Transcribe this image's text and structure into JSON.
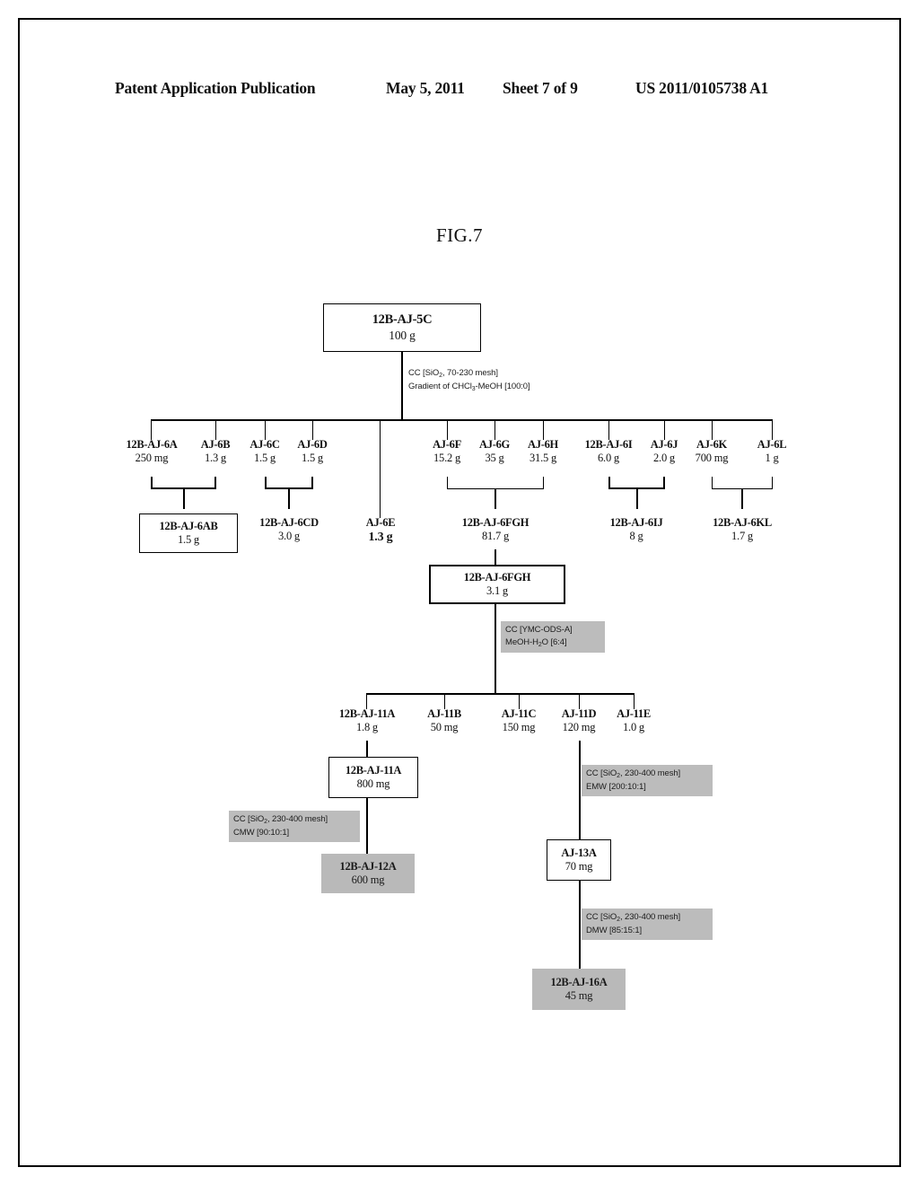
{
  "header": {
    "publication": "Patent Application Publication",
    "date": "May 5, 2011",
    "sheet": "Sheet 7 of 9",
    "number": "US 2011/0105738 A1"
  },
  "figure": {
    "title": "FIG.7",
    "type": "flowchart",
    "description": "Isolation / fractionation scheme of extract 12B-AJ-5C"
  },
  "nodes": {
    "root": {
      "name": "12B-AJ-5C",
      "weight": "100 g"
    },
    "aj6a": {
      "name": "12B-AJ-6A",
      "weight": "250 mg"
    },
    "aj6b": {
      "name": "AJ-6B",
      "weight": "1.3 g"
    },
    "aj6c": {
      "name": "AJ-6C",
      "weight": "1.5 g"
    },
    "aj6d": {
      "name": "AJ-6D",
      "weight": "1.5 g"
    },
    "aj6e": {
      "name": "AJ-6E",
      "weight": "1.3 g"
    },
    "aj6f": {
      "name": "AJ-6F",
      "weight": "15.2 g"
    },
    "aj6g": {
      "name": "AJ-6G",
      "weight": "35 g"
    },
    "aj6h": {
      "name": "AJ-6H",
      "weight": "31.5 g"
    },
    "aj6i": {
      "name": "12B-AJ-6I",
      "weight": "6.0 g"
    },
    "aj6j": {
      "name": "AJ-6J",
      "weight": "2.0 g"
    },
    "aj6k": {
      "name": "AJ-6K",
      "weight": "700 mg"
    },
    "aj6l": {
      "name": "AJ-6L",
      "weight": "1 g"
    },
    "aj6ab": {
      "name": "12B-AJ-6AB",
      "weight": "1.5 g"
    },
    "aj6cd": {
      "name": "12B-AJ-6CD",
      "weight": "3.0 g"
    },
    "aj6fgh_top": {
      "name": "12B-AJ-6FGH",
      "weight": "81.7 g"
    },
    "aj6ij": {
      "name": "12B-AJ-6IJ",
      "weight": "8 g"
    },
    "aj6kl": {
      "name": "12B-AJ-6KL",
      "weight": "1.7 g"
    },
    "aj6fgh_box": {
      "name": "12B-AJ-6FGH",
      "weight": "3.1 g"
    },
    "aj11a": {
      "name": "12B-AJ-11A",
      "weight": "1.8 g"
    },
    "aj11b": {
      "name": "AJ-11B",
      "weight": "50 mg"
    },
    "aj11c": {
      "name": "AJ-11C",
      "weight": "150 mg"
    },
    "aj11d": {
      "name": "AJ-11D",
      "weight": "120 mg"
    },
    "aj11e": {
      "name": "AJ-11E",
      "weight": "1.0 g"
    },
    "aj11a_box": {
      "name": "12B-AJ-11A",
      "weight": "800 mg"
    },
    "aj12a": {
      "name": "12B-AJ-12A",
      "weight": "600 mg"
    },
    "aj13a": {
      "name": "AJ-13A",
      "weight": "70 mg"
    },
    "aj16a": {
      "name": "12B-AJ-16A",
      "weight": "45 mg"
    }
  },
  "annotations": {
    "cc_root_l1": "CC [SiO",
    "cc_root_l1b": "2",
    "cc_root_l1c": ", 70-230 mesh]",
    "cc_root_l2": "Gradient of CHCl",
    "cc_root_l2b": "3",
    "cc_root_l2c": "-MeOH [100:0]",
    "cc_ods_l1": "CC [YMC-ODS-A]",
    "cc_ods_l2": "MeOH-H",
    "cc_ods_l2b": "2",
    "cc_ods_l2c": "O [6:4]",
    "cc_cmw_l1": "CC [SiO",
    "cc_cmw_l1b": "2",
    "cc_cmw_l1c": ", 230-400 mesh]",
    "cc_cmw_l2": "CMW [90:10:1]",
    "cc_emw_l1": "CC [SiO",
    "cc_emw_l1b": "2",
    "cc_emw_l1c": ", 230-400 mesh]",
    "cc_emw_l2": "EMW [200:10:1]",
    "cc_dmw_l1": "CC [SiO",
    "cc_dmw_l1b": "2",
    "cc_dmw_l1c": ", 230-400 mesh]",
    "cc_dmw_l2": "DMW [85:15:1]"
  },
  "colors": {
    "ink": "#111111",
    "shade": "#b9b9b9",
    "paper": "#ffffff"
  }
}
